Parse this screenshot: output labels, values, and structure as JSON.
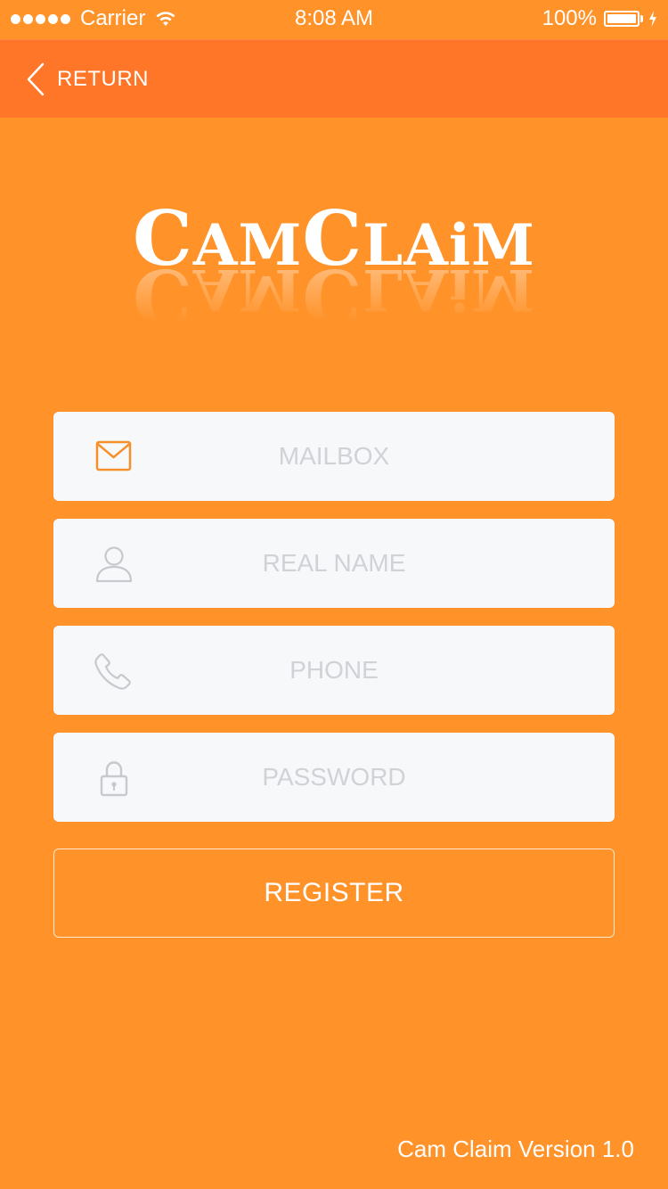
{
  "status_bar": {
    "carrier": "Carrier",
    "time": "8:08 AM",
    "battery": "100%"
  },
  "nav": {
    "back_label": "RETURN"
  },
  "logo": {
    "text_big1": "C",
    "text_small1": "AM",
    "text_big2": "C",
    "text_small2": "LAiM"
  },
  "form": {
    "mailbox_placeholder": "MAILBOX",
    "real_name_placeholder": "REAL NAME",
    "phone_placeholder": "PHONE",
    "password_placeholder": "PASSWORD",
    "register_label": "REGISTER"
  },
  "footer": {
    "version": "Cam Claim Version 1.0"
  },
  "colors": {
    "background": "#ff9228",
    "nav_background": "#ff7628",
    "field_background": "#f7f8fa",
    "accent_icon": "#f5902c",
    "placeholder": "#cfd2d6"
  },
  "icons": {
    "mailbox": "envelope-icon",
    "real_name": "user-icon",
    "phone": "phone-icon",
    "password": "lock-icon",
    "back": "chevron-left-icon"
  }
}
